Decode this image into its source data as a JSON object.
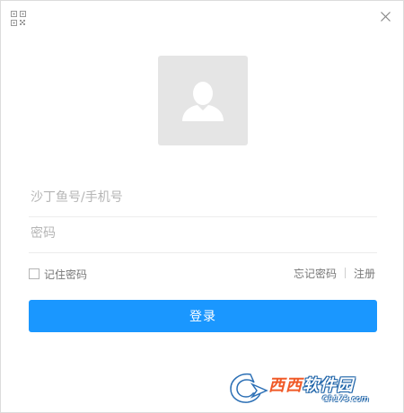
{
  "header": {
    "qr_icon": "qr-code-icon",
    "close_icon": "close-icon"
  },
  "avatar": {
    "icon": "user-icon",
    "bg_color": "#e5e5e5"
  },
  "form": {
    "username_placeholder": "沙丁鱼号/手机号",
    "password_placeholder": "密码",
    "remember_label": "记住密码",
    "forgot_label": "忘记密码",
    "register_label": "注册",
    "login_label": "登录"
  },
  "watermark": {
    "main_blue": "软件园",
    "main_red": "西西",
    "sub": "CR173.com"
  },
  "colors": {
    "primary": "#1a97ff",
    "placeholder": "#b5b5b5",
    "avatar_bg": "#e5e5e5"
  }
}
